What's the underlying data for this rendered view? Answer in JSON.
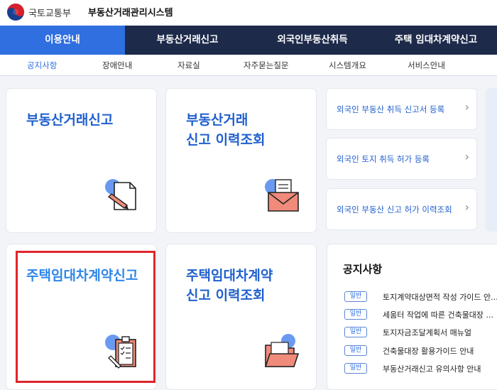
{
  "header": {
    "ministry": "국토교통부",
    "system_name": "부동산거래관리시스템"
  },
  "nav": {
    "items": [
      {
        "label": "이용안내",
        "active": true
      },
      {
        "label": "부동산거래신고",
        "active": false
      },
      {
        "label": "외국인부동산취득",
        "active": false
      },
      {
        "label": "주택 임대차계약신고",
        "active": false
      }
    ]
  },
  "subnav": {
    "items": [
      {
        "label": "공지사항",
        "active": true
      },
      {
        "label": "장애안내",
        "active": false
      },
      {
        "label": "자료실",
        "active": false
      },
      {
        "label": "자주묻는질문",
        "active": false
      },
      {
        "label": "시스템개요",
        "active": false
      },
      {
        "label": "서비스안내",
        "active": false
      }
    ]
  },
  "cards": {
    "report": {
      "title": "부동산거래신고",
      "icon": "pen-paper-icon"
    },
    "report_history": {
      "title": "부동산거래\n신고 이력조회",
      "icon": "envelope-icon"
    },
    "lease_report": {
      "title": "주택임대차계약신고",
      "icon": "clipboard-icon"
    },
    "lease_history": {
      "title": "주택임대차계약\n신고 이력조회",
      "icon": "folder-icon"
    }
  },
  "links": [
    {
      "label": "외국인 부동산 취득 신고서 등록"
    },
    {
      "label": "외국인 토지 취득 허가 등록"
    },
    {
      "label": "외국인 부동산 신고 허가 이력조회"
    }
  ],
  "notice": {
    "title": "공지사항",
    "badge": "일반",
    "items": [
      {
        "text": "토지계약대상면적 작성 가이드 안..."
      },
      {
        "text": "세움터 작업에 따른 건축물대장 ..."
      },
      {
        "text": "토지자금조달계획서 매뉴얼"
      },
      {
        "text": "건축물대장 활용가이드 안내"
      },
      {
        "text": "부동산거래신고 유의사항 안내"
      }
    ]
  },
  "colors": {
    "nav_bg": "#1d2a4a",
    "accent": "#2f6fe0",
    "highlight": "#e0252b"
  }
}
